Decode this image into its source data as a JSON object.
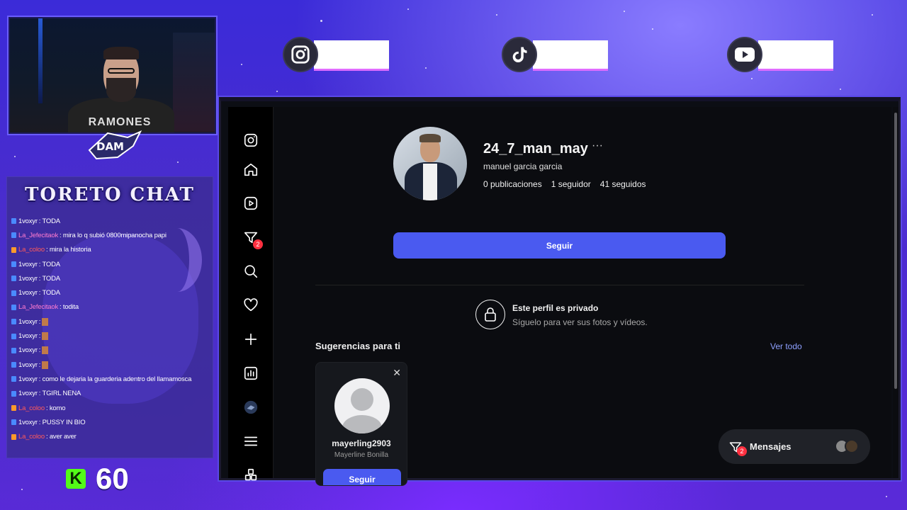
{
  "overlay": {
    "chat_title": "TORETO CHAT",
    "kick_count": "60",
    "kick_logo": "K",
    "cam_shirt_text": "RAMONES",
    "chat_messages": [
      {
        "user": "1voxyr",
        "text": ": TODA",
        "partial": true
      },
      {
        "user": "La_Jefecitaok",
        "text": ": mira lo q subió 0800mipanocha papi",
        "color": "pink"
      },
      {
        "user": "La_coloo",
        "text": ": mira la historia",
        "color": "red"
      },
      {
        "user": "1voxyr",
        "text": ": TODA"
      },
      {
        "user": "1voxyr",
        "text": ": TODA"
      },
      {
        "user": "1voxyr",
        "text": ": TODA"
      },
      {
        "user": "La_Jefecitaok",
        "text": ": todita",
        "color": "pink"
      },
      {
        "user": "1voxyr",
        "text": ":",
        "emoji": true
      },
      {
        "user": "1voxyr",
        "text": ":",
        "emoji": true
      },
      {
        "user": "1voxyr",
        "text": ":",
        "emoji": true
      },
      {
        "user": "1voxyr",
        "text": ":",
        "emoji": true
      },
      {
        "user": "1voxyr",
        "text": ": como le dejaria la guarderia adentro del llamamosca"
      },
      {
        "user": "1voxyr",
        "text": ": TGIRL NENA"
      },
      {
        "user": "La_coloo",
        "text": ": komo",
        "color": "red"
      },
      {
        "user": "1voxyr",
        "text": ": PUSSY IN BIO"
      },
      {
        "user": "La_coloo",
        "text": ": aver aver",
        "color": "red"
      }
    ],
    "social_icons": [
      "instagram-icon",
      "tiktok-icon",
      "youtube-icon"
    ]
  },
  "instagram": {
    "sidebar_icons": [
      "instagram-logo-icon",
      "home-icon",
      "reels-icon",
      "messages-icon",
      "search-icon",
      "heart-icon",
      "create-icon",
      "dashboard-icon",
      "profile-avatar-icon",
      "menu-icon",
      "apps-icon"
    ],
    "messages_badge": "2",
    "profile": {
      "username": "24_7_man_may",
      "more": "···",
      "full_name": "manuel garcia garcia",
      "posts": "0 publicaciones",
      "followers": "1 seguidor",
      "following": "41 seguidos",
      "follow_label": "Seguir"
    },
    "private": {
      "title": "Este perfil es privado",
      "subtitle": "Síguelo para ver sus fotos y vídeos."
    },
    "suggestions": {
      "title": "Sugerencias para ti",
      "see_all": "Ver todo",
      "cards": [
        {
          "username": "mayerling2903",
          "name": "Mayerline Bonilla",
          "button": "Seguir",
          "close": "✕"
        }
      ]
    },
    "messages_bar": {
      "label": "Mensajes",
      "badge": "2"
    }
  },
  "colors": {
    "accent_blue": "#4a5af0",
    "link_blue": "#8ea0ff",
    "notif_red": "#ff3040",
    "kick_green": "#53fc18"
  }
}
